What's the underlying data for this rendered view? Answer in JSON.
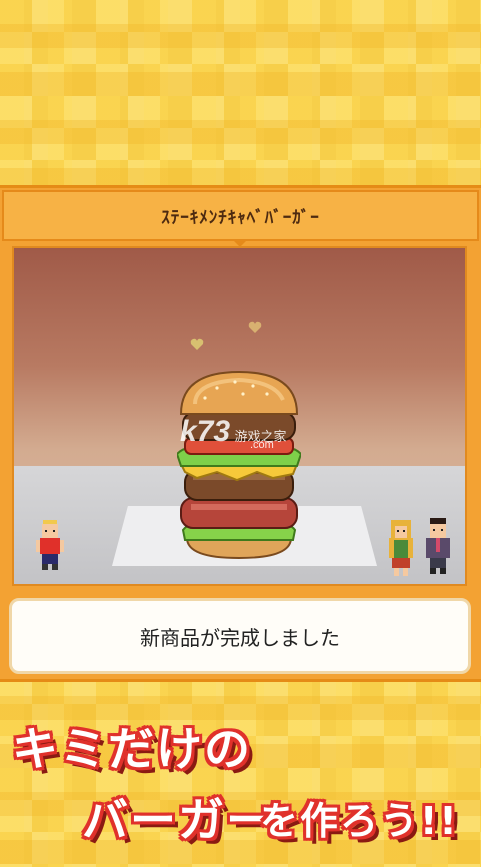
{
  "product": {
    "name": "ｽﾃｰｷﾒﾝﾁｷｬﾍﾞﾊﾞｰｶﾞｰ"
  },
  "message": "新商品が完成しました",
  "watermark": {
    "brand": "k73",
    "site": "游戏之家",
    "domain": ".com"
  },
  "slogan": {
    "line1": "キミだけの",
    "line2_part1": "バーガー",
    "line2_part2": "を作ろう!!"
  },
  "colors": {
    "panel": "#f3a233",
    "accent_red": "#e0312b",
    "background_yellow": "#f7cf4a"
  }
}
